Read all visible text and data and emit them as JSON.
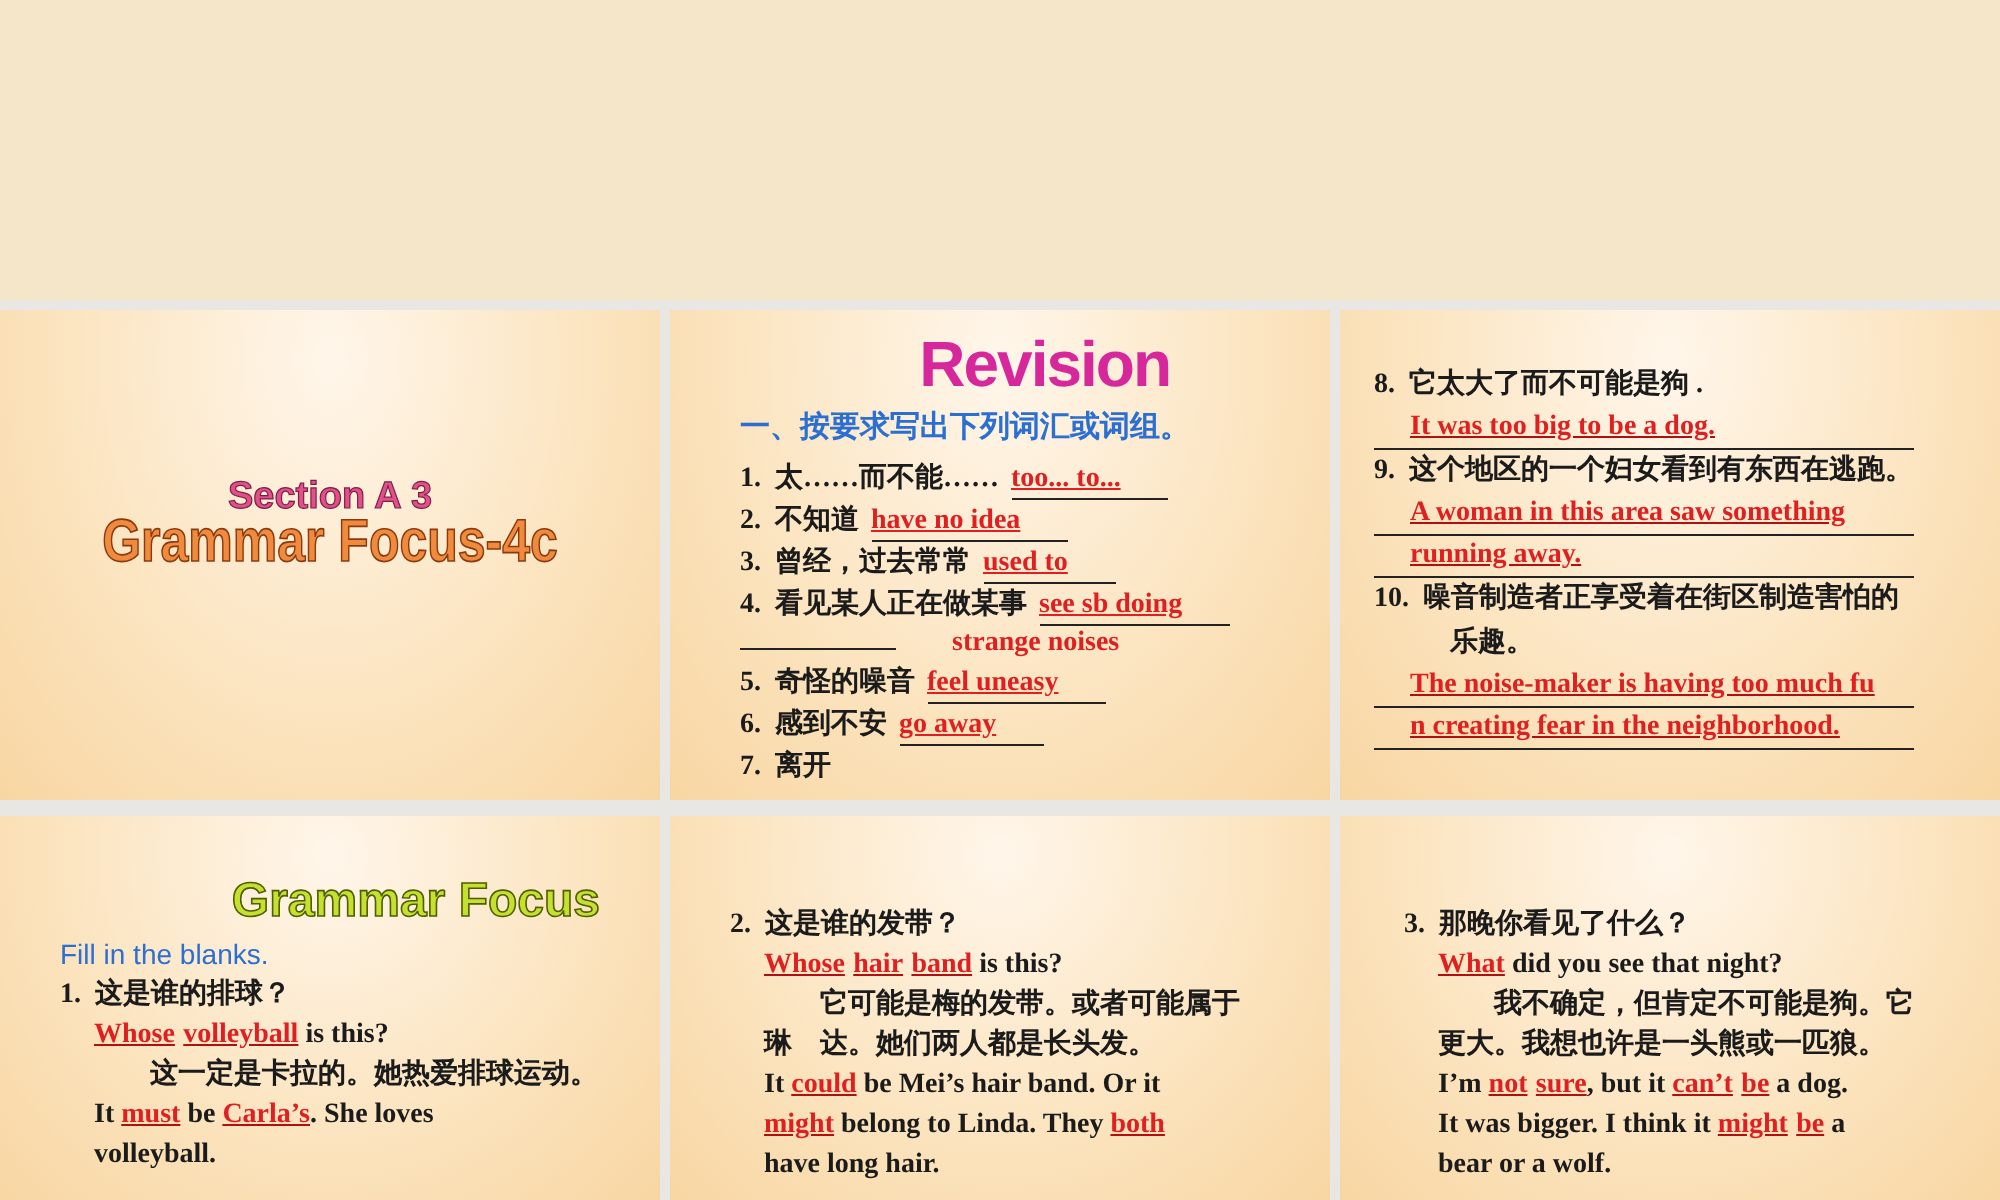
{
  "slides": [
    {
      "kind": "title",
      "title_lines": [
        "Section A 3",
        "Grammar Focus-4c"
      ]
    },
    {
      "kind": "exercise",
      "heading": "Revision",
      "subheading": "一、按要求写出下列词汇或词组。",
      "lines": [
        {
          "kind": "numbered",
          "number": "1.",
          "parts": [
            {
              "kind": "plain",
              "text": "太……而不能……"
            },
            {
              "kind": "answer",
              "text": "too... to..."
            }
          ]
        },
        {
          "kind": "numbered",
          "number": "2.",
          "parts": [
            {
              "kind": "plain",
              "text": "不知道"
            },
            {
              "kind": "answer",
              "text": "have no idea"
            }
          ]
        },
        {
          "kind": "numbered",
          "number": "3.",
          "parts": [
            {
              "kind": "plain",
              "text": "曾经，过去常常"
            },
            {
              "kind": "answer",
              "text": "used to"
            }
          ]
        },
        {
          "kind": "numbered",
          "number": "4.",
          "parts": [
            {
              "kind": "plain",
              "text": "看见某人正在做某事"
            },
            {
              "kind": "answer",
              "text": "see sb doing"
            }
          ]
        },
        {
          "kind": "blank",
          "parts": [
            {
              "kind": "answer",
              "text": "strange noises"
            }
          ]
        },
        {
          "kind": "numbered",
          "number": "5.",
          "parts": [
            {
              "kind": "plain",
              "text": "奇怪的噪音"
            },
            {
              "kind": "answer",
              "text": "feel uneasy"
            }
          ]
        },
        {
          "kind": "numbered",
          "number": "6.",
          "parts": [
            {
              "kind": "plain",
              "text": "感到不安"
            },
            {
              "kind": "answer",
              "text": "go away"
            }
          ]
        },
        {
          "kind": "numbered",
          "number": "7.",
          "parts": [
            {
              "kind": "plain",
              "text": "离开"
            }
          ]
        }
      ]
    },
    {
      "kind": "exercise",
      "lines": [
        {
          "kind": "numbered",
          "number": "8.",
          "parts": [
            {
              "kind": "plain",
              "text": "它太大了而不可能是狗 ."
            }
          ]
        },
        {
          "kind": "answer",
          "parts": [
            {
              "kind": "answer",
              "text": "It was too big to be a dog."
            }
          ]
        },
        {
          "kind": "numbered",
          "number": "9.",
          "parts": [
            {
              "kind": "plain",
              "text": "这个地区的一个妇女看到有东西在逃跑。"
            }
          ]
        },
        {
          "kind": "answer",
          "parts": [
            {
              "kind": "answer",
              "text": "A woman in this area saw something"
            }
          ]
        },
        {
          "kind": "answer",
          "parts": [
            {
              "kind": "answer",
              "text": "running away."
            }
          ]
        },
        {
          "kind": "numbered",
          "number": "10.",
          "parts": [
            {
              "kind": "plain",
              "text": "噪音制造者正享受着在街区制造害怕的"
            }
          ]
        },
        {
          "kind": "cont",
          "parts": [
            {
              "kind": "plain",
              "text": "乐趣。"
            }
          ]
        },
        {
          "kind": "answer",
          "parts": [
            {
              "kind": "answer",
              "text": "The noise-maker is having too much fu"
            }
          ]
        },
        {
          "kind": "answer",
          "parts": [
            {
              "kind": "answer",
              "text": "n creating fear in the neighborhood."
            }
          ]
        }
      ]
    },
    {
      "kind": "exercise",
      "heading": "Grammar Focus",
      "subheading": "Fill in the blanks.",
      "lines": [
        {
          "kind": "numbered",
          "number": "1.",
          "parts": [
            {
              "kind": "plain",
              "text": "这是谁的排球？"
            }
          ]
        },
        {
          "kind": "cont",
          "parts": [
            {
              "kind": "answer",
              "text": "Whose"
            },
            {
              "kind": "answer",
              "text": "volleyball"
            },
            {
              "kind": "plain",
              "text": " is this?"
            }
          ]
        },
        {
          "kind": "para",
          "parts": [
            {
              "kind": "plain",
              "text": "这一定是卡拉的。她热爱排球运动。"
            }
          ]
        },
        {
          "kind": "cont",
          "parts": [
            {
              "kind": "plain",
              "text": "It "
            },
            {
              "kind": "answer",
              "text": "must"
            },
            {
              "kind": "plain",
              "text": " be "
            },
            {
              "kind": "answer",
              "text": "Carla’s"
            },
            {
              "kind": "plain",
              "text": ". She loves"
            }
          ]
        },
        {
          "kind": "cont",
          "parts": [
            {
              "kind": "plain",
              "text": "volleyball."
            }
          ]
        }
      ]
    },
    {
      "kind": "exercise",
      "lines": [
        {
          "kind": "numbered",
          "number": "2.",
          "parts": [
            {
              "kind": "plain",
              "text": "这是谁的发带？"
            }
          ]
        },
        {
          "kind": "cont",
          "parts": [
            {
              "kind": "answer",
              "text": "Whose"
            },
            {
              "kind": "answer",
              "text": "hair"
            },
            {
              "kind": "answer",
              "text": "band"
            },
            {
              "kind": "plain",
              "text": " is this?"
            }
          ]
        },
        {
          "kind": "para",
          "parts": [
            {
              "kind": "plain",
              "text": "它可能是梅的发带。或者可能属于"
            }
          ]
        },
        {
          "kind": "cont",
          "parts": [
            {
              "kind": "plain",
              "text": "琳　达。她们两人都是长头发。"
            }
          ]
        },
        {
          "kind": "cont",
          "parts": [
            {
              "kind": "plain",
              "text": "It "
            },
            {
              "kind": "answer",
              "text": "could"
            },
            {
              "kind": "plain",
              "text": " be Mei’s hair band. Or it"
            }
          ]
        },
        {
          "kind": "cont",
          "parts": [
            {
              "kind": "answer",
              "text": "might"
            },
            {
              "kind": "plain",
              "text": " belong to Linda. They "
            },
            {
              "kind": "answer",
              "text": "both"
            }
          ]
        },
        {
          "kind": "cont",
          "parts": [
            {
              "kind": "plain",
              "text": "have long hair."
            }
          ]
        }
      ]
    },
    {
      "kind": "exercise",
      "lines": [
        {
          "kind": "numbered",
          "number": "3.",
          "parts": [
            {
              "kind": "plain",
              "text": "那晚你看见了什么？"
            }
          ]
        },
        {
          "kind": "cont",
          "parts": [
            {
              "kind": "answer",
              "text": "What"
            },
            {
              "kind": "plain",
              "text": " did you see that night?"
            }
          ]
        },
        {
          "kind": "para",
          "parts": [
            {
              "kind": "plain",
              "text": "我不确定，但肯定不可能是狗。它"
            }
          ]
        },
        {
          "kind": "cont",
          "parts": [
            {
              "kind": "plain",
              "text": "更大。我想也许是一头熊或一匹狼。"
            }
          ]
        },
        {
          "kind": "cont",
          "parts": [
            {
              "kind": "plain",
              "text": "I’m "
            },
            {
              "kind": "answer",
              "text": "not"
            },
            {
              "kind": "answer",
              "text": "sure"
            },
            {
              "kind": "plain",
              "text": ", but it "
            },
            {
              "kind": "answer",
              "text": "can’t"
            },
            {
              "kind": "answer",
              "text": "be"
            },
            {
              "kind": "plain",
              "text": " a dog."
            }
          ]
        },
        {
          "kind": "cont",
          "parts": [
            {
              "kind": "plain",
              "text": "It was bigger. I think it "
            },
            {
              "kind": "answer",
              "text": "might"
            },
            {
              "kind": "answer",
              "text": "be"
            },
            {
              "kind": "plain",
              "text": " a"
            }
          ]
        },
        {
          "kind": "cont",
          "parts": [
            {
              "kind": "plain",
              "text": "bear or a wolf."
            }
          ]
        }
      ]
    }
  ]
}
